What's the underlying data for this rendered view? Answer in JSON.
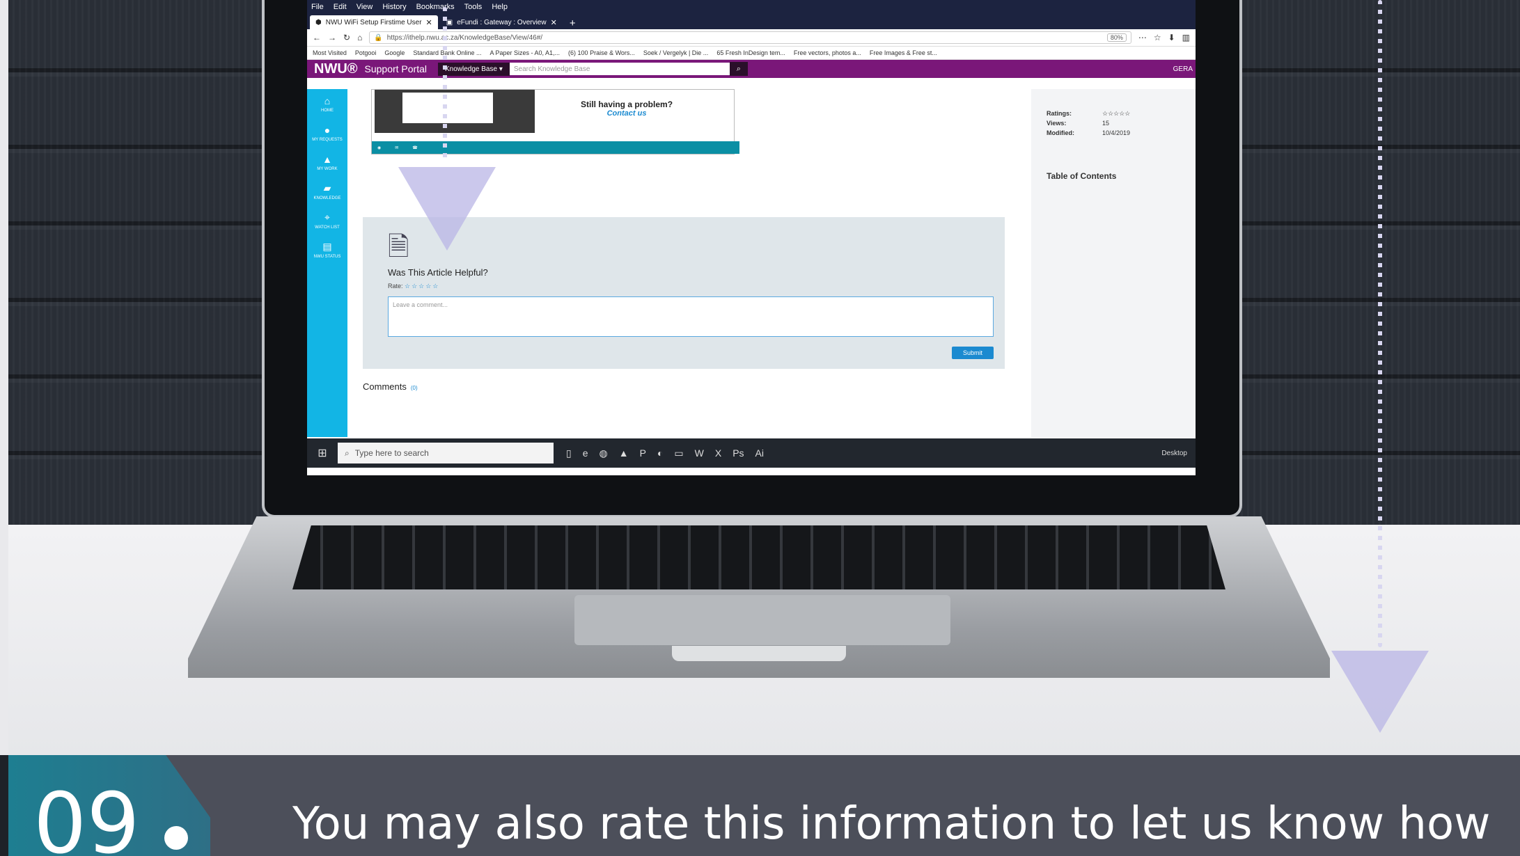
{
  "browser": {
    "menu": [
      "File",
      "Edit",
      "View",
      "History",
      "Bookmarks",
      "Tools",
      "Help"
    ],
    "tabs": [
      {
        "label": "NWU WiFi Setup Firstime User"
      },
      {
        "label": "eFundi : Gateway : Overview"
      }
    ],
    "url": "https://ithelp.nwu.ac.za/KnowledgeBase/View/46#/",
    "zoom": "80%",
    "bookmarks": [
      "Most Visited",
      "Potgooi",
      "Google",
      "Standard Bank Online ...",
      "A Paper Sizes - A0, A1,...",
      "(6) 100 Praise & Wors...",
      "Soek / Vergelyk | Die ...",
      "65 Fresh InDesign tem...",
      "Free vectors, photos a...",
      "Free Images & Free st..."
    ]
  },
  "site": {
    "logo": "NWU®",
    "portal": "Support Portal",
    "kb_button": "Knowledge Base ▾",
    "search_placeholder": "Search Knowledge Base",
    "user": "GERA",
    "nav": [
      "HOME",
      "MY REQUESTS",
      "MY WORK",
      "KNOWLEDGE",
      "WATCH LIST",
      "NWU STATUS"
    ]
  },
  "banner": {
    "help_title": "Still having a problem?",
    "help_link": "Contact us"
  },
  "feedback": {
    "question": "Was This Article Helpful?",
    "rate_label": "Rate:",
    "stars": "☆☆☆☆☆",
    "comment_placeholder": "Leave a comment...",
    "submit": "Submit"
  },
  "comments": {
    "label": "Comments",
    "count": "(0)"
  },
  "sidebar_meta": {
    "ratings_label": "Ratings:",
    "ratings_value": "☆☆☆☆☆",
    "views_label": "Views:",
    "views_value": "15",
    "modified_label": "Modified:",
    "modified_value": "10/4/2019",
    "toc": "Table of Contents"
  },
  "taskbar": {
    "search": "Type here to search",
    "desktop": "Desktop"
  },
  "caption": {
    "step": "09",
    "text": "You may also rate this information to let us know how"
  },
  "colors": {
    "accent_purple": "#7a1779",
    "nav_cyan": "#12b5e5",
    "caption_bg": "#4c4f5a",
    "badge_teal": "#1e7e91"
  }
}
